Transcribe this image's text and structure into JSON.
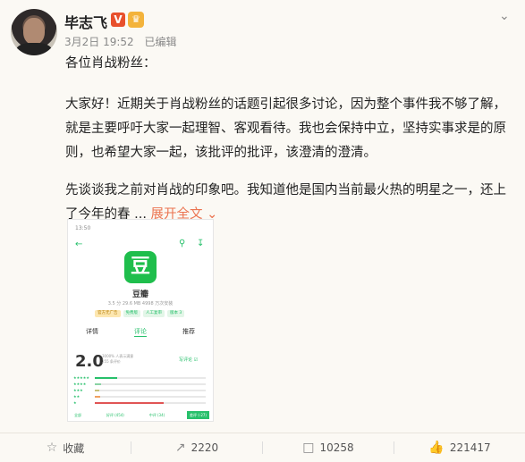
{
  "author": {
    "name": "毕志飞",
    "verified_badge": "V",
    "vip_badge": "♛"
  },
  "post": {
    "date": "3月2日 19:52",
    "edited": "已编辑",
    "greeting": "各位肖战粉丝：",
    "p1": "大家好！近期关于肖战粉丝的话题引起很多讨论，因为整个事件我不够了解，就是主要呼吁大家一起理智、客观看待。我也会保持中立，坚持实事求是的原则，也希望大家一起，该批评的批评，该澄清的澄清。",
    "p2": "先谈谈我之前对肖战的印象吧。我知道他是国内当前最火热的明星之一，还上了今年的春 ...",
    "expand": "展开全文",
    "expand_icon": "chevron-down"
  },
  "embedded_image": {
    "status_time": "13:50",
    "app_icon_char": "豆",
    "app_name": "豆瓣",
    "app_meta": "3.5 分   29.6 MB   4998 万次安装",
    "tags": [
      {
        "label": "官方无广告",
        "bg": "#fde7b0",
        "fg": "#b57b00"
      },
      {
        "label": "免费版",
        "bg": "#e3f6e8",
        "fg": "#27c06b"
      },
      {
        "label": "人工复审",
        "bg": "#e3f6e8",
        "fg": "#27c06b"
      },
      {
        "label": "版本 3",
        "bg": "#e3f6e8",
        "fg": "#27c06b"
      }
    ],
    "tabs": [
      "详情",
      "评论",
      "推荐"
    ],
    "rating": "2.0",
    "rating_note_1": "3000% 人表示满意",
    "rating_note_2": "255 条评价",
    "write_review": "写评论 ☑",
    "bottom_buttons": [
      "全部",
      "好评 (454)",
      "中评 (34)",
      "差评 (-27)"
    ]
  },
  "actions": {
    "favorite": "收藏",
    "repost": "2220",
    "comment": "10258",
    "like": "221417"
  },
  "colors": {
    "accent": "#eb7350",
    "green": "#27c06b",
    "background": "#fbf9f4"
  }
}
